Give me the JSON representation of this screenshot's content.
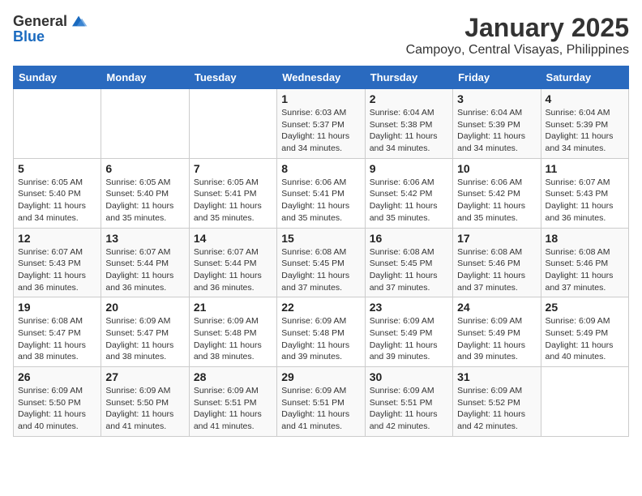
{
  "header": {
    "logo_general": "General",
    "logo_blue": "Blue",
    "title": "January 2025",
    "subtitle": "Campoyo, Central Visayas, Philippines"
  },
  "days_of_week": [
    "Sunday",
    "Monday",
    "Tuesday",
    "Wednesday",
    "Thursday",
    "Friday",
    "Saturday"
  ],
  "weeks": [
    [
      {
        "day": "",
        "info": ""
      },
      {
        "day": "",
        "info": ""
      },
      {
        "day": "",
        "info": ""
      },
      {
        "day": "1",
        "info": "Sunrise: 6:03 AM\nSunset: 5:37 PM\nDaylight: 11 hours and 34 minutes."
      },
      {
        "day": "2",
        "info": "Sunrise: 6:04 AM\nSunset: 5:38 PM\nDaylight: 11 hours and 34 minutes."
      },
      {
        "day": "3",
        "info": "Sunrise: 6:04 AM\nSunset: 5:39 PM\nDaylight: 11 hours and 34 minutes."
      },
      {
        "day": "4",
        "info": "Sunrise: 6:04 AM\nSunset: 5:39 PM\nDaylight: 11 hours and 34 minutes."
      }
    ],
    [
      {
        "day": "5",
        "info": "Sunrise: 6:05 AM\nSunset: 5:40 PM\nDaylight: 11 hours and 34 minutes."
      },
      {
        "day": "6",
        "info": "Sunrise: 6:05 AM\nSunset: 5:40 PM\nDaylight: 11 hours and 35 minutes."
      },
      {
        "day": "7",
        "info": "Sunrise: 6:05 AM\nSunset: 5:41 PM\nDaylight: 11 hours and 35 minutes."
      },
      {
        "day": "8",
        "info": "Sunrise: 6:06 AM\nSunset: 5:41 PM\nDaylight: 11 hours and 35 minutes."
      },
      {
        "day": "9",
        "info": "Sunrise: 6:06 AM\nSunset: 5:42 PM\nDaylight: 11 hours and 35 minutes."
      },
      {
        "day": "10",
        "info": "Sunrise: 6:06 AM\nSunset: 5:42 PM\nDaylight: 11 hours and 35 minutes."
      },
      {
        "day": "11",
        "info": "Sunrise: 6:07 AM\nSunset: 5:43 PM\nDaylight: 11 hours and 36 minutes."
      }
    ],
    [
      {
        "day": "12",
        "info": "Sunrise: 6:07 AM\nSunset: 5:43 PM\nDaylight: 11 hours and 36 minutes."
      },
      {
        "day": "13",
        "info": "Sunrise: 6:07 AM\nSunset: 5:44 PM\nDaylight: 11 hours and 36 minutes."
      },
      {
        "day": "14",
        "info": "Sunrise: 6:07 AM\nSunset: 5:44 PM\nDaylight: 11 hours and 36 minutes."
      },
      {
        "day": "15",
        "info": "Sunrise: 6:08 AM\nSunset: 5:45 PM\nDaylight: 11 hours and 37 minutes."
      },
      {
        "day": "16",
        "info": "Sunrise: 6:08 AM\nSunset: 5:45 PM\nDaylight: 11 hours and 37 minutes."
      },
      {
        "day": "17",
        "info": "Sunrise: 6:08 AM\nSunset: 5:46 PM\nDaylight: 11 hours and 37 minutes."
      },
      {
        "day": "18",
        "info": "Sunrise: 6:08 AM\nSunset: 5:46 PM\nDaylight: 11 hours and 37 minutes."
      }
    ],
    [
      {
        "day": "19",
        "info": "Sunrise: 6:08 AM\nSunset: 5:47 PM\nDaylight: 11 hours and 38 minutes."
      },
      {
        "day": "20",
        "info": "Sunrise: 6:09 AM\nSunset: 5:47 PM\nDaylight: 11 hours and 38 minutes."
      },
      {
        "day": "21",
        "info": "Sunrise: 6:09 AM\nSunset: 5:48 PM\nDaylight: 11 hours and 38 minutes."
      },
      {
        "day": "22",
        "info": "Sunrise: 6:09 AM\nSunset: 5:48 PM\nDaylight: 11 hours and 39 minutes."
      },
      {
        "day": "23",
        "info": "Sunrise: 6:09 AM\nSunset: 5:49 PM\nDaylight: 11 hours and 39 minutes."
      },
      {
        "day": "24",
        "info": "Sunrise: 6:09 AM\nSunset: 5:49 PM\nDaylight: 11 hours and 39 minutes."
      },
      {
        "day": "25",
        "info": "Sunrise: 6:09 AM\nSunset: 5:49 PM\nDaylight: 11 hours and 40 minutes."
      }
    ],
    [
      {
        "day": "26",
        "info": "Sunrise: 6:09 AM\nSunset: 5:50 PM\nDaylight: 11 hours and 40 minutes."
      },
      {
        "day": "27",
        "info": "Sunrise: 6:09 AM\nSunset: 5:50 PM\nDaylight: 11 hours and 41 minutes."
      },
      {
        "day": "28",
        "info": "Sunrise: 6:09 AM\nSunset: 5:51 PM\nDaylight: 11 hours and 41 minutes."
      },
      {
        "day": "29",
        "info": "Sunrise: 6:09 AM\nSunset: 5:51 PM\nDaylight: 11 hours and 41 minutes."
      },
      {
        "day": "30",
        "info": "Sunrise: 6:09 AM\nSunset: 5:51 PM\nDaylight: 11 hours and 42 minutes."
      },
      {
        "day": "31",
        "info": "Sunrise: 6:09 AM\nSunset: 5:52 PM\nDaylight: 11 hours and 42 minutes."
      },
      {
        "day": "",
        "info": ""
      }
    ]
  ]
}
